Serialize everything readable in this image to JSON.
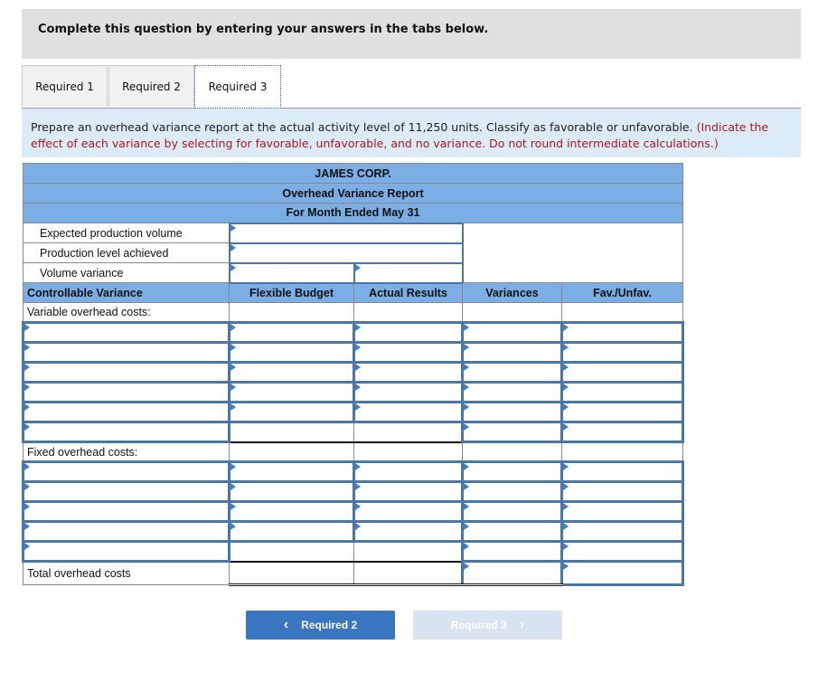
{
  "banner": {
    "text": "Complete this question by entering your answers in the tabs below."
  },
  "tabs": [
    {
      "label": "Required 1",
      "active": false
    },
    {
      "label": "Required 2",
      "active": false
    },
    {
      "label": "Required 3",
      "active": true
    }
  ],
  "instructions": {
    "main": "Prepare an overhead variance report at the actual activity level of 11,250 units. Classify as favorable or unfavorable. ",
    "note": "(Indicate the effect of each variance by selecting for favorable, unfavorable, and no variance. Do not round intermediate calculations.)"
  },
  "report": {
    "company": "JAMES CORP.",
    "title": "Overhead Variance Report",
    "period": "For Month Ended May 31",
    "volume_rows": [
      {
        "label": "Expected production volume",
        "value": ""
      },
      {
        "label": "Production level achieved",
        "value": ""
      },
      {
        "label": "Volume variance",
        "value_1": "",
        "value_2": ""
      }
    ],
    "columns": {
      "section": "Controllable Variance",
      "flexible_budget": "Flexible Budget",
      "actual_results": "Actual Results",
      "variances": "Variances",
      "fav_unfav": "Fav./Unfav."
    },
    "variable_label": "Variable overhead costs:",
    "fixed_label": "Fixed overhead costs:",
    "total_label": "Total overhead costs"
  },
  "nav": {
    "prev_label": "Required 2",
    "next_label": "Required 3",
    "prev_icon": "‹",
    "next_icon": "›"
  }
}
